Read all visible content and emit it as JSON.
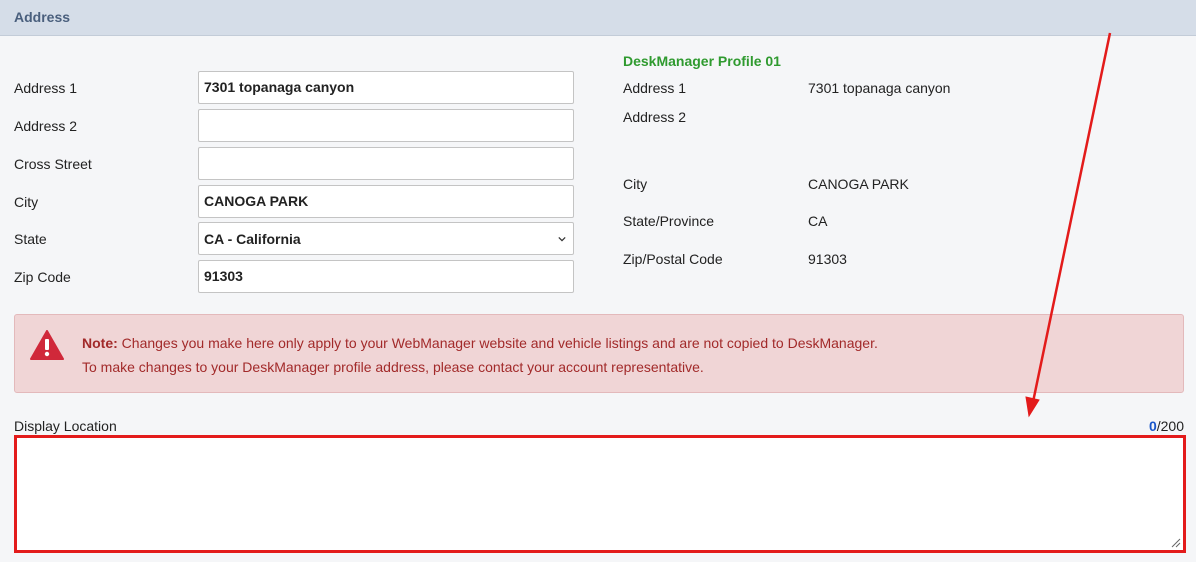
{
  "section": {
    "title": "Address"
  },
  "form": {
    "address1": {
      "label": "Address 1",
      "value": "7301 topanaga canyon"
    },
    "address2": {
      "label": "Address 2",
      "value": ""
    },
    "cross_street": {
      "label": "Cross Street",
      "value": ""
    },
    "city": {
      "label": "City",
      "value": "CANOGA PARK"
    },
    "state": {
      "label": "State",
      "value": "CA - California"
    },
    "zip": {
      "label": "Zip Code",
      "value": "91303"
    }
  },
  "profile": {
    "title": "DeskManager Profile 01",
    "address1": {
      "label": "Address 1",
      "value": "7301 topanaga canyon"
    },
    "address2": {
      "label": "Address 2",
      "value": ""
    },
    "city": {
      "label": "City",
      "value": "CANOGA PARK"
    },
    "state": {
      "label": "State/Province",
      "value": "CA"
    },
    "zip": {
      "label": "Zip/Postal Code",
      "value": "91303"
    }
  },
  "note": {
    "prefix": "Note:",
    "line1": " Changes you make here only apply to your WebManager website and vehicle listings and are not copied to DeskManager.",
    "line2": "To make changes to your DeskManager profile address, please contact your account representative."
  },
  "display_location": {
    "label": "Display Location",
    "count": "0",
    "max": "/200",
    "value": ""
  },
  "colors": {
    "header_bg": "#d5dde8",
    "header_text": "#4a5f7d",
    "profile_title": "#2f9a2f",
    "note_bg": "#f0d5d6",
    "note_text": "#a22a2a",
    "highlight": "#e31b1b"
  },
  "icons": {
    "warning": "warning-triangle-icon",
    "select": "chevron-down-icon",
    "resize": "resize-grip-icon"
  }
}
